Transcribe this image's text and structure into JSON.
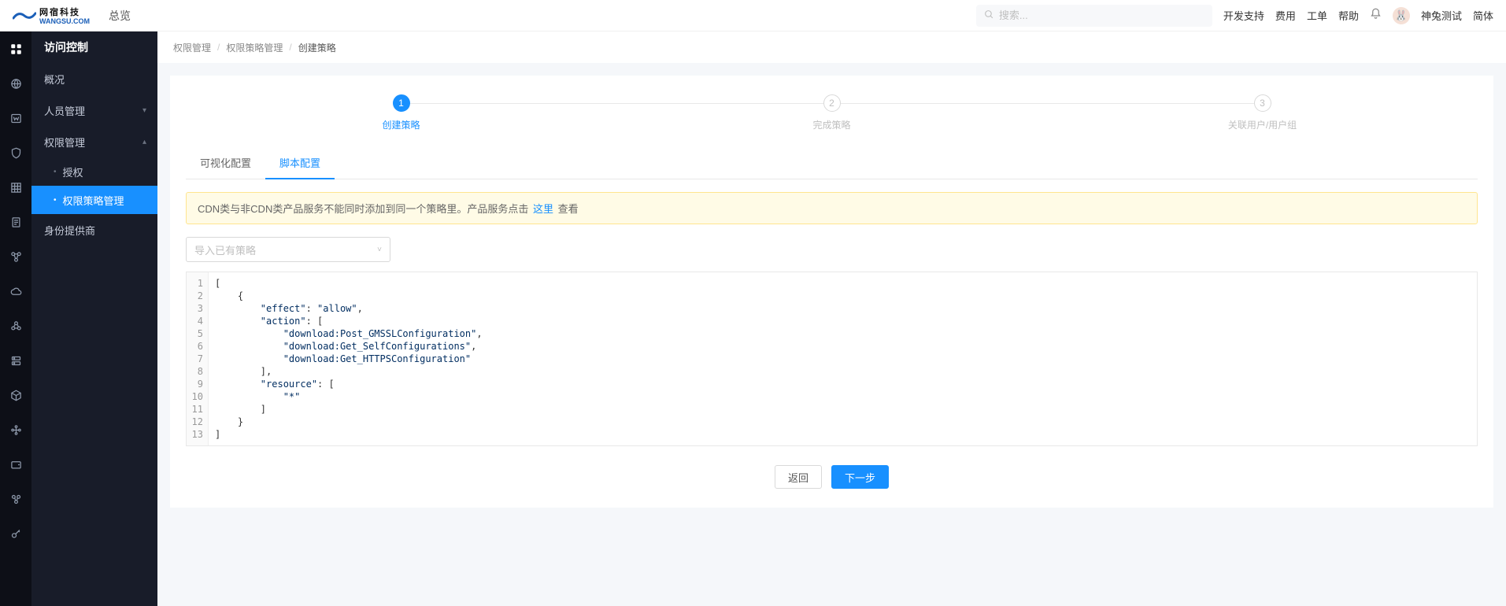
{
  "header": {
    "logo_cn": "网宿科技",
    "logo_en": "WANGSU.COM",
    "nav_overview": "总览",
    "search_placeholder": "搜索...",
    "links": {
      "dev_support": "开发支持",
      "fee": "费用",
      "ticket": "工单",
      "help": "帮助"
    },
    "username": "神兔测试",
    "lang": "简体"
  },
  "sidemenu": {
    "title": "访问控制",
    "overview": "概况",
    "people_mgmt": "人员管理",
    "perm_mgmt": "权限管理",
    "auth": "授权",
    "policy_mgmt": "权限策略管理",
    "idp": "身份提供商"
  },
  "breadcrumb": {
    "a": "权限管理",
    "b": "权限策略管理",
    "c": "创建策略"
  },
  "steps": {
    "s1": "创建策略",
    "s2": "完成策略",
    "s3": "关联用户/用户组"
  },
  "tabs": {
    "visual": "可视化配置",
    "script": "脚本配置"
  },
  "alert": {
    "pre": "CDN类与非CDN类产品服务不能同时添加到同一个策略里。产品服务点击 ",
    "link": "这里",
    "post": " 查看"
  },
  "select_placeholder": "导入已有策略",
  "code_lines": [
    "[",
    "    {",
    "        \"effect\": \"allow\",",
    "        \"action\": [",
    "            \"download:Post_GMSSLConfiguration\",",
    "            \"download:Get_SelfConfigurations\",",
    "            \"download:Get_HTTPSConfiguration\"",
    "        ],",
    "        \"resource\": [",
    "            \"*\"",
    "        ]",
    "    }",
    "]"
  ],
  "buttons": {
    "back": "返回",
    "next": "下一步"
  }
}
